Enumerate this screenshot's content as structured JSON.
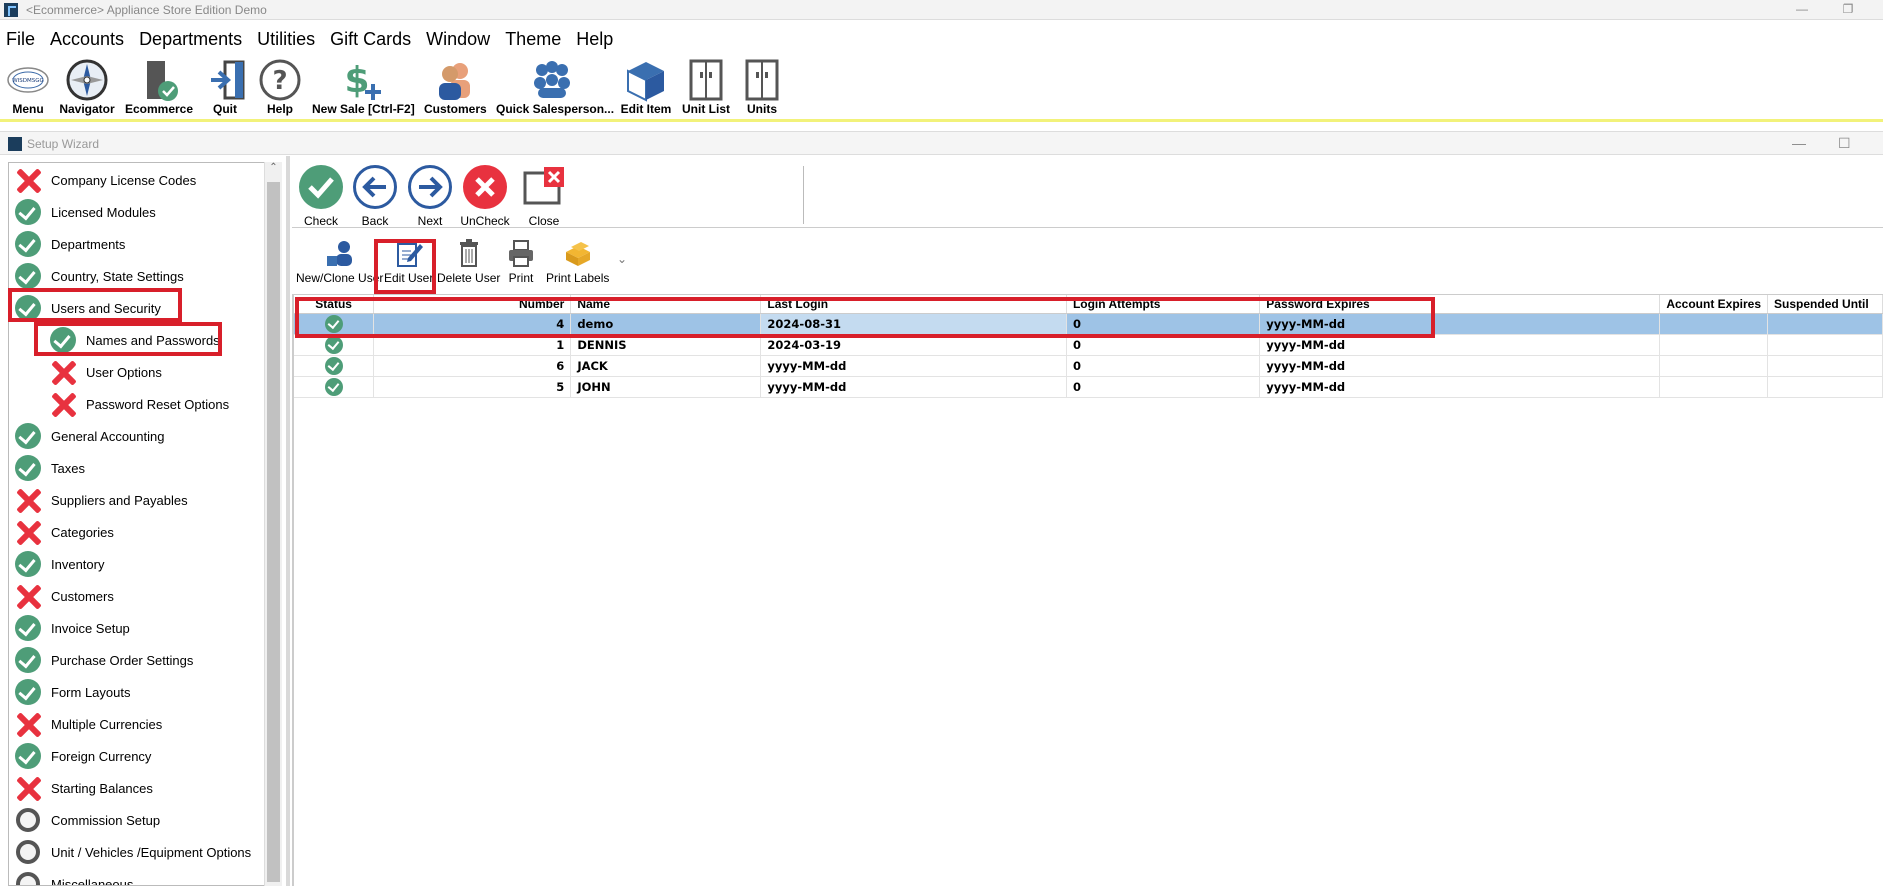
{
  "window": {
    "title": "<Ecommerce> Appliance Store Edition Demo",
    "minimize": "—",
    "restore": "❐"
  },
  "menubar": [
    "File",
    "Accounts",
    "Departments",
    "Utilities",
    "Gift Cards",
    "Window",
    "Theme",
    "Help"
  ],
  "toolbar": {
    "menu": "Menu",
    "navigator": "Navigator",
    "ecommerce": "Ecommerce",
    "quit": "Quit",
    "help": "Help",
    "new_sale": "New Sale [Ctrl-F2]",
    "customers": "Customers",
    "quick_salesperson": "Quick Salesperson...",
    "edit_item": "Edit Item",
    "unit_list": "Unit List",
    "units": "Units",
    "logo_text": "WISDMSGG"
  },
  "child_window": {
    "title": "Setup Wizard",
    "minimize": "—",
    "maximize": "☐"
  },
  "wizard_steps": [
    {
      "label": "Company License Codes",
      "status": "missing"
    },
    {
      "label": "Licensed Modules",
      "status": "done"
    },
    {
      "label": "Departments",
      "status": "done"
    },
    {
      "label": "Country, State Settings",
      "status": "done"
    },
    {
      "label": "Users and Security",
      "status": "done"
    },
    {
      "label": "Names and Passwords",
      "status": "done"
    },
    {
      "label": "User Options",
      "status": "missing"
    },
    {
      "label": "Password Reset Options",
      "status": "missing"
    },
    {
      "label": "General Accounting",
      "status": "done"
    },
    {
      "label": "Taxes",
      "status": "done"
    },
    {
      "label": "Suppliers and Payables",
      "status": "missing"
    },
    {
      "label": "Categories",
      "status": "missing"
    },
    {
      "label": "Inventory",
      "status": "done"
    },
    {
      "label": "Customers",
      "status": "missing"
    },
    {
      "label": "Invoice Setup",
      "status": "done"
    },
    {
      "label": "Purchase Order Settings",
      "status": "done"
    },
    {
      "label": "Form Layouts",
      "status": "done"
    },
    {
      "label": "Multiple Currencies",
      "status": "missing"
    },
    {
      "label": "Foreign Currency",
      "status": "done"
    },
    {
      "label": "Starting Balances",
      "status": "missing"
    },
    {
      "label": "Commission Setup",
      "status": "pending"
    },
    {
      "label": "Unit / Vehicles /Equipment Options",
      "status": "pending"
    },
    {
      "label": "Miscellaneous",
      "status": "pending"
    }
  ],
  "wizard_nav": {
    "check": "Check",
    "back": "Back",
    "next": "Next",
    "uncheck": "UnCheck",
    "close": "Close"
  },
  "user_toolbar": {
    "new_clone": "New/Clone User",
    "edit": "Edit User",
    "delete": "Delete User",
    "print": "Print",
    "print_labels": "Print Labels",
    "more": "⌄"
  },
  "grid": {
    "columns": [
      "Status",
      "Number",
      "Name",
      "Last Login",
      "Login Attempts",
      "Password Expires",
      "Account Expires",
      "Suspended Until"
    ],
    "rows": [
      {
        "number": "4",
        "name": "demo",
        "last_login": "2024-08-31",
        "attempts": "0",
        "pw_expires": "yyyy-MM-dd",
        "acct_expires": "",
        "suspended": ""
      },
      {
        "number": "1",
        "name": "DENNIS",
        "last_login": "2024-03-19",
        "attempts": "0",
        "pw_expires": "yyyy-MM-dd",
        "acct_expires": "",
        "suspended": ""
      },
      {
        "number": "6",
        "name": "JACK",
        "last_login": "yyyy-MM-dd",
        "attempts": "0",
        "pw_expires": "yyyy-MM-dd",
        "acct_expires": "",
        "suspended": ""
      },
      {
        "number": "5",
        "name": "JOHN",
        "last_login": "yyyy-MM-dd",
        "attempts": "0",
        "pw_expires": "yyyy-MM-dd",
        "acct_expires": "",
        "suspended": ""
      }
    ]
  },
  "colors": {
    "done": "#4e9d78",
    "missing": "#e8323f",
    "highlight": "#d81f2a",
    "selected_row": "#9ec3e6"
  }
}
